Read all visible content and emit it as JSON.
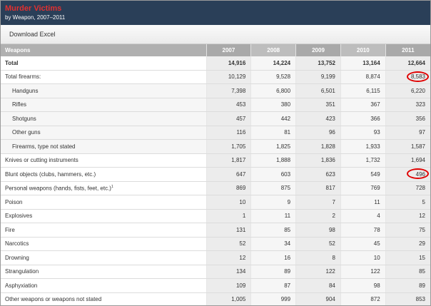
{
  "header": {
    "title": "Murder Victims",
    "subtitle": "by Weapon, 2007–2011"
  },
  "toolbar": {
    "download_label": "Download Excel"
  },
  "table": {
    "label_header": "Weapons",
    "years": [
      "2007",
      "2008",
      "2009",
      "2010",
      "2011"
    ],
    "rows": [
      {
        "label": "Total",
        "values": [
          "14,916",
          "14,224",
          "13,752",
          "13,164",
          "12,664"
        ],
        "bold": true
      },
      {
        "label": "Total firearms:",
        "values": [
          "10,129",
          "9,528",
          "9,199",
          "8,874",
          "8,583"
        ],
        "highlight": 4
      },
      {
        "label": "Handguns",
        "values": [
          "7,398",
          "6,800",
          "6,501",
          "6,115",
          "6,220"
        ],
        "sub": true
      },
      {
        "label": "Rifles",
        "values": [
          "453",
          "380",
          "351",
          "367",
          "323"
        ],
        "sub": true
      },
      {
        "label": "Shotguns",
        "values": [
          "457",
          "442",
          "423",
          "366",
          "356"
        ],
        "sub": true
      },
      {
        "label": "Other guns",
        "values": [
          "116",
          "81",
          "96",
          "93",
          "97"
        ],
        "sub": true
      },
      {
        "label": "Firearms, type not stated",
        "values": [
          "1,705",
          "1,825",
          "1,828",
          "1,933",
          "1,587"
        ],
        "sub": true
      },
      {
        "label": "Knives or cutting instruments",
        "values": [
          "1,817",
          "1,888",
          "1,836",
          "1,732",
          "1,694"
        ]
      },
      {
        "label": "Blunt objects (clubs, hammers, etc.)",
        "values": [
          "647",
          "603",
          "623",
          "549",
          "496"
        ],
        "highlight": 4
      },
      {
        "label": "Personal weapons (hands, fists, feet, etc.)",
        "sup": "1",
        "values": [
          "869",
          "875",
          "817",
          "769",
          "728"
        ]
      },
      {
        "label": "Poison",
        "values": [
          "10",
          "9",
          "7",
          "11",
          "5"
        ]
      },
      {
        "label": "Explosives",
        "values": [
          "1",
          "11",
          "2",
          "4",
          "12"
        ]
      },
      {
        "label": "Fire",
        "values": [
          "131",
          "85",
          "98",
          "78",
          "75"
        ]
      },
      {
        "label": "Narcotics",
        "values": [
          "52",
          "34",
          "52",
          "45",
          "29"
        ]
      },
      {
        "label": "Drowning",
        "values": [
          "12",
          "16",
          "8",
          "10",
          "15"
        ]
      },
      {
        "label": "Strangulation",
        "values": [
          "134",
          "89",
          "122",
          "122",
          "85"
        ]
      },
      {
        "label": "Asphyxiation",
        "values": [
          "109",
          "87",
          "84",
          "98",
          "89"
        ]
      },
      {
        "label": "Other weapons or weapons not stated",
        "values": [
          "1,005",
          "999",
          "904",
          "872",
          "853"
        ]
      }
    ]
  },
  "colors": {
    "title_bg": "#2a3f58",
    "title_text": "#e23030",
    "highlight_circle": "#e00000"
  }
}
